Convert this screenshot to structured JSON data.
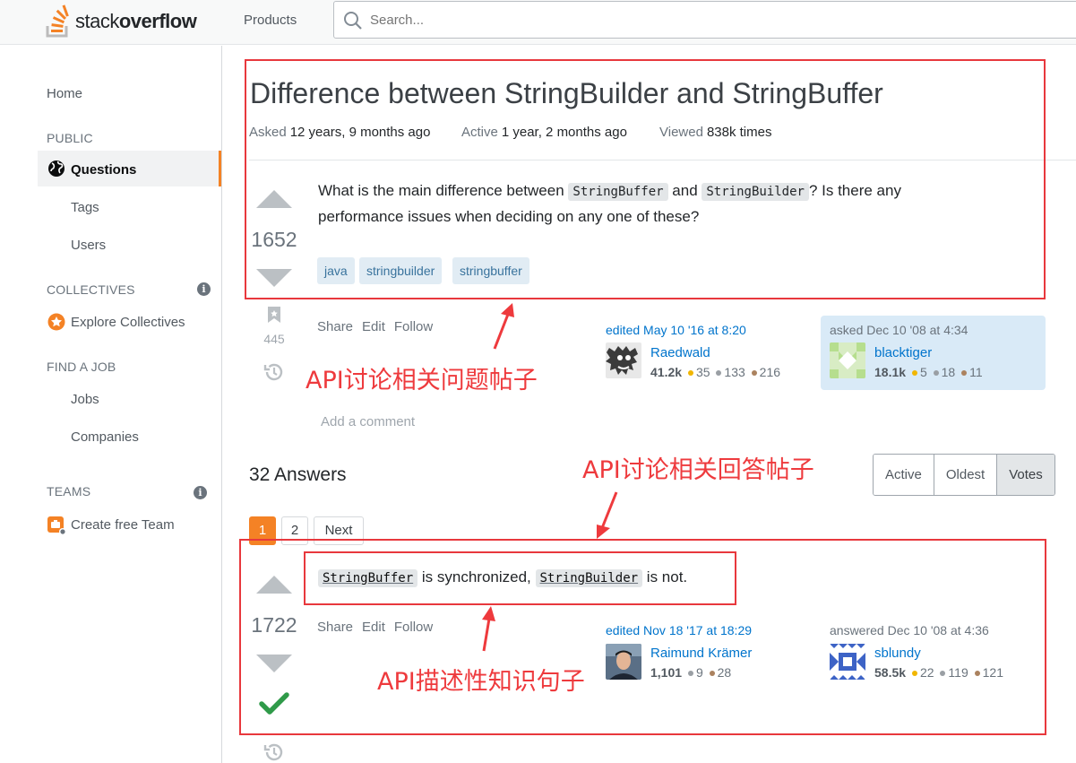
{
  "header": {
    "logo_light": "stack",
    "logo_bold": "overflow",
    "products": "Products",
    "search_placeholder": "Search..."
  },
  "sidebar": {
    "home": "Home",
    "public": "PUBLIC",
    "questions": "Questions",
    "tags": "Tags",
    "users": "Users",
    "collectives": "COLLECTIVES",
    "explore_collectives": "Explore Collectives",
    "find_job": "FIND A JOB",
    "jobs": "Jobs",
    "companies": "Companies",
    "teams": "TEAMS",
    "create_team": "Create free Team",
    "info": "i"
  },
  "question": {
    "title": "Difference between StringBuilder and StringBuffer",
    "asked_label": "Asked",
    "asked_value": "12 years, 9 months ago",
    "active_label": "Active",
    "active_value": "1 year, 2 months ago",
    "viewed_label": "Viewed",
    "viewed_value": "838k times",
    "votes": "1652",
    "body_part1": "What is the main difference between ",
    "code1": "StringBuffer",
    "body_part2": " and ",
    "code2": "StringBuilder",
    "body_part3": "? Is there any",
    "body_line2": "performance issues when deciding on any one of these?",
    "tags": [
      "java",
      "stringbuilder",
      "stringbuffer"
    ],
    "bookmark_count": "445",
    "menu": [
      "Share",
      "Edit",
      "Follow"
    ],
    "edited": {
      "label": "edited May 10 '16 at 8:20",
      "name": "Raedwald",
      "rep": "41.2k",
      "gold": "35",
      "silver": "133",
      "bronze": "216"
    },
    "asked_card": {
      "label": "asked Dec 10 '08 at 4:34",
      "name": "blacktiger",
      "rep": "18.1k",
      "gold": "5",
      "silver": "18",
      "bronze": "11"
    },
    "add_comment": "Add a comment"
  },
  "answers": {
    "count_label": "32 Answers",
    "sort": [
      "Active",
      "Oldest",
      "Votes"
    ],
    "active_sort": "Votes",
    "pages": [
      "1",
      "2",
      "Next"
    ]
  },
  "answer": {
    "votes": "1722",
    "code1": "StringBuffer",
    "text1": " is synchronized, ",
    "code2": "StringBuilder",
    "text2": " is not.",
    "menu": [
      "Share",
      "Edit",
      "Follow"
    ],
    "edited": {
      "label": "edited Nov 18 '17 at 18:29",
      "name": "Raimund Krämer",
      "rep": "1,101",
      "silver": "9",
      "bronze": "28"
    },
    "answered": {
      "label": "answered Dec 10 '08 at 4:36",
      "name": "sblundy",
      "rep": "58.5k",
      "gold": "22",
      "silver": "119",
      "bronze": "121"
    }
  },
  "annotations": {
    "question_post": "API讨论相关问题帖子",
    "answer_post": "API讨论相关回答帖子",
    "knowledge_sentence": "API描述性知识句子",
    "color": "#e8383d"
  }
}
